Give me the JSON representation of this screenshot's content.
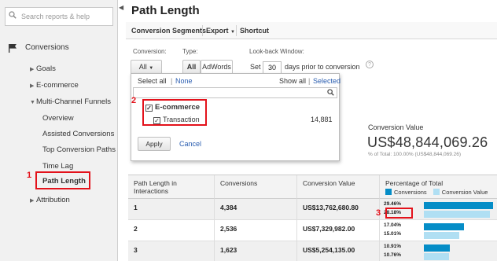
{
  "sidebar": {
    "search_placeholder": "Search reports & help",
    "section": "Conversions",
    "items": [
      {
        "label": "Goals",
        "caret": "▶"
      },
      {
        "label": "E-commerce",
        "caret": "▶"
      },
      {
        "label": "Multi-Channel Funnels",
        "caret": "▼"
      },
      {
        "label": "Overview"
      },
      {
        "label": "Assisted Conversions"
      },
      {
        "label": "Top Conversion Paths"
      },
      {
        "label": "Time Lag"
      },
      {
        "label": "Path Length"
      },
      {
        "label": "Attribution",
        "caret": "▶"
      }
    ]
  },
  "annotations": {
    "one": "1",
    "two": "2",
    "three": "3"
  },
  "main": {
    "title": "Path Length",
    "toolbar": {
      "segments": "Conversion Segments",
      "export": "Export",
      "shortcut": "Shortcut"
    },
    "filters": {
      "conversion_label": "Conversion:",
      "conversion_value": "All",
      "type_label": "Type:",
      "type_all": "All",
      "type_adwords": "AdWords",
      "lookback_label": "Look-back Window:",
      "set_label": "Set",
      "lookback_days": "30",
      "days_suffix": "days prior to conversion"
    },
    "dropdown": {
      "select_all": "Select all",
      "separator": "|",
      "none": "None",
      "show_all": "Show all",
      "selected": "Selected",
      "group_label": "E-commerce",
      "child_label": "Transaction",
      "child_count": "14,881",
      "apply": "Apply",
      "cancel": "Cancel"
    },
    "summary": {
      "label": "Conversion Value",
      "value": "US$48,844,069.26",
      "sub": "% of Total: 100.00% (US$48,844,069.26)"
    },
    "table": {
      "headers": [
        "Path Length in Interactions",
        "Conversions",
        "Conversion Value",
        "Percentage of Total"
      ],
      "legend": {
        "conversions": "Conversions",
        "conversion_value": "Conversion Value"
      },
      "rows": [
        {
          "length": "1",
          "conversions": "4,384",
          "value": "US$13,762,680.80",
          "pct_conv": "29.46%",
          "pct_val": "28.18%",
          "conv_frac": 0.2946,
          "val_frac": 0.2818
        },
        {
          "length": "2",
          "conversions": "2,536",
          "value": "US$7,329,982.00",
          "pct_conv": "17.04%",
          "pct_val": "15.01%",
          "conv_frac": 0.1704,
          "val_frac": 0.1501
        },
        {
          "length": "3",
          "conversions": "1,623",
          "value": "US$5,254,135.00",
          "pct_conv": "10.91%",
          "pct_val": "10.76%",
          "conv_frac": 0.1091,
          "val_frac": 0.1076
        }
      ]
    }
  },
  "colors": {
    "conversions": "#058dc7",
    "conversion_value": "#b0dff3",
    "highlight": "#e3121b",
    "link": "#2a5db0"
  },
  "icons": {
    "search": "search-icon",
    "flag": "flag-icon",
    "help": "help-icon",
    "checkbox": "checkbox-checked-icon"
  }
}
